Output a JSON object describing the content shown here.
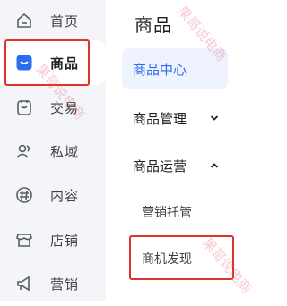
{
  "sidebar": {
    "items": [
      {
        "label": "首页",
        "icon": "home-icon"
      },
      {
        "label": "商品",
        "icon": "product-icon",
        "active": true
      },
      {
        "label": "交易",
        "icon": "order-icon"
      },
      {
        "label": "私域",
        "icon": "users-icon"
      },
      {
        "label": "内容",
        "icon": "hashtag-icon"
      },
      {
        "label": "店铺",
        "icon": "store-icon"
      },
      {
        "label": "营销",
        "icon": "megaphone-icon"
      }
    ]
  },
  "panel": {
    "title": "商品",
    "active_item": "商品中心",
    "groups": [
      {
        "label": "商品管理",
        "expanded": false
      },
      {
        "label": "商品运营",
        "expanded": true,
        "children": [
          "营销托管",
          "商机发现"
        ]
      }
    ]
  },
  "watermark": "果哥说电商",
  "colors": {
    "accent": "#2b6cf0",
    "highlight_box": "#e0322c",
    "rail_bg": "#f4f5f9"
  }
}
